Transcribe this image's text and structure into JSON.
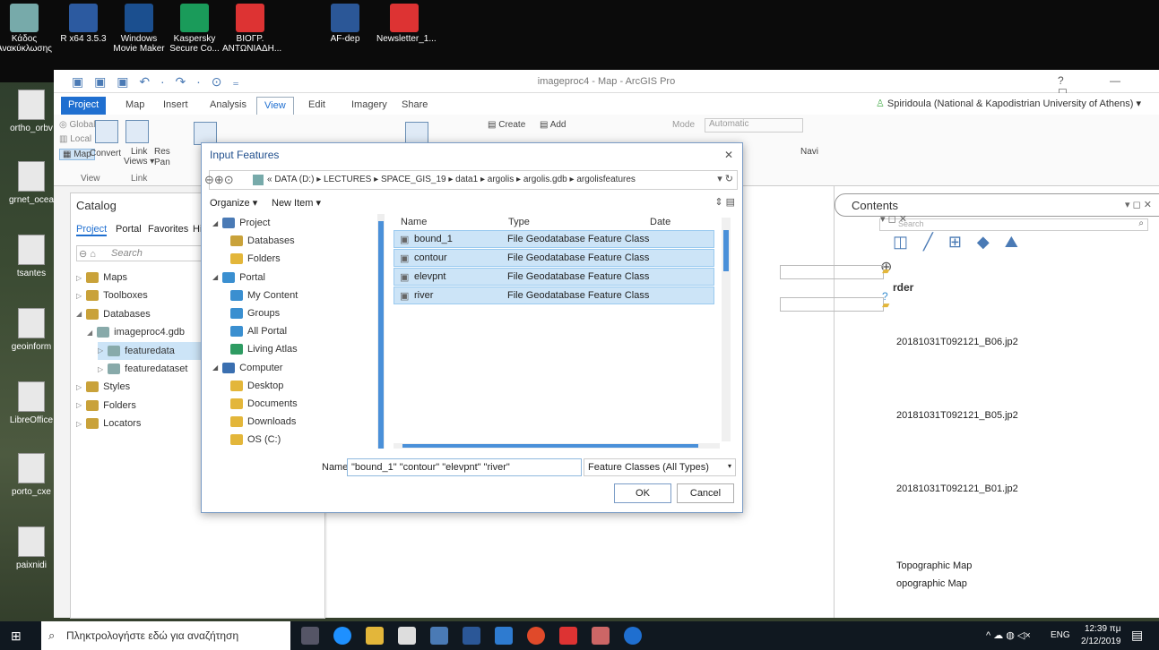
{
  "desktop_icons": [
    {
      "label": "Κάδος\nΑνακύκλωσης",
      "icon": "recycle-bin-icon",
      "color": "#7aa"
    },
    {
      "label": "R x64 3.5.3",
      "icon": "r-icon",
      "color": "#2c5aa0"
    },
    {
      "label": "Windows\nMovie Maker",
      "icon": "movie-maker-icon",
      "color": "#1b4f8f"
    },
    {
      "label": "Kaspersky\nSecure Co...",
      "icon": "kaspersky-icon",
      "color": "#1a9b5a"
    },
    {
      "label": "ΒΙΟΓΡ.\nΑΝΤΩΝΙΑΔΗ...",
      "icon": "pdf-icon",
      "color": "#d33"
    },
    {
      "label": "AF-dep",
      "icon": "word-icon",
      "color": "#2b5797"
    },
    {
      "label": "Newsletter_1...",
      "icon": "pdf-icon",
      "color": "#d33"
    }
  ],
  "side_icons": [
    "ortho_orbv",
    "grnet_ocea",
    "tsantes",
    "geoinform",
    "LibreOffice",
    "porto_cxe",
    "paixnidi"
  ],
  "arcgis": {
    "title": "imageproc4 - Map - ArcGIS Pro",
    "user": "Spiridoula (National & Kapodistrian University of Athens) ▾",
    "tabs": [
      "Project",
      "Map",
      "Insert",
      "Analysis",
      "View",
      "Edit",
      "Imagery",
      "Share"
    ],
    "active_tab": "View",
    "ribbon": {
      "global": "Global",
      "local": "Local",
      "map": "Map",
      "convert": "Convert",
      "link_views": "Link\nViews ▾",
      "res": "Res",
      "pan": "Pan",
      "view_group": "View",
      "link_group": "Link",
      "create": "Create",
      "add": "Add",
      "mode": "Mode",
      "automatic": "Automatic",
      "navi": "Navi"
    }
  },
  "catalog": {
    "title": "Catalog",
    "tabs": [
      "Project",
      "Portal",
      "Favorites",
      "His"
    ],
    "search_placeholder": "Search",
    "tree": [
      {
        "label": "Maps",
        "indent": 0
      },
      {
        "label": "Toolboxes",
        "indent": 0
      },
      {
        "label": "Databases",
        "indent": 0,
        "expanded": true
      },
      {
        "label": "imageproc4.gdb",
        "indent": 1,
        "expanded": true
      },
      {
        "label": "featuredata",
        "indent": 2,
        "selected": true
      },
      {
        "label": "featuredataset",
        "indent": 2
      },
      {
        "label": "Styles",
        "indent": 0
      },
      {
        "label": "Folders",
        "indent": 0
      },
      {
        "label": "Locators",
        "indent": 0
      }
    ]
  },
  "contents": {
    "title": "Contents",
    "search_placeholder": "Search",
    "order_label": "rder"
  },
  "geo_items": [
    "20181031T092121_B06.jp2",
    "20181031T092121_B05.jp2",
    "20181031T092121_B01.jp2",
    "Topographic Map",
    "opographic Map"
  ],
  "dialog": {
    "title": "Input Features",
    "breadcrumb": [
      "«  DATA (D:)",
      "LECTURES",
      "SPACE_GIS_19",
      "data1",
      "argolis",
      "argolis.gdb",
      "argolisfeatures"
    ],
    "organize": "Organize ▾",
    "new_item": "New Item ▾",
    "nav": [
      {
        "label": "Project",
        "indent": 0,
        "color": "#4a7ab5"
      },
      {
        "label": "Databases",
        "indent": 1,
        "color": "#c9a23a"
      },
      {
        "label": "Folders",
        "indent": 1,
        "color": "#e3b63a"
      },
      {
        "label": "Portal",
        "indent": 0,
        "color": "#3a8fd0"
      },
      {
        "label": "My Content",
        "indent": 1,
        "color": "#3a8fd0"
      },
      {
        "label": "Groups",
        "indent": 1,
        "color": "#3a8fd0"
      },
      {
        "label": "All Portal",
        "indent": 1,
        "color": "#3a8fd0"
      },
      {
        "label": "Living Atlas",
        "indent": 1,
        "color": "#2e9b62"
      },
      {
        "label": "Computer",
        "indent": 0,
        "color": "#3a6fb0"
      },
      {
        "label": "Desktop",
        "indent": 1,
        "color": "#e3b63a"
      },
      {
        "label": "Documents",
        "indent": 1,
        "color": "#e3b63a"
      },
      {
        "label": "Downloads",
        "indent": 1,
        "color": "#e3b63a"
      },
      {
        "label": "OS (C:)",
        "indent": 1,
        "color": "#e3b63a"
      }
    ],
    "columns": [
      "Name",
      "Type",
      "Date"
    ],
    "files": [
      {
        "name": "bound_1",
        "type": "File Geodatabase Feature Class"
      },
      {
        "name": "contour",
        "type": "File Geodatabase Feature Class"
      },
      {
        "name": "elevpnt",
        "type": "File Geodatabase Feature Class"
      },
      {
        "name": "river",
        "type": "File Geodatabase Feature Class"
      }
    ],
    "name_label": "Name",
    "name_value": "\"bound_1\" \"contour\" \"elevpnt\" \"river\"",
    "filter": "Feature Classes (All Types)",
    "ok": "OK",
    "cancel": "Cancel"
  },
  "taskbar": {
    "search_placeholder": "Πληκτρολογήστε εδώ για αναζήτηση",
    "lang": "ENG",
    "time": "12:39 πμ",
    "date": "2/12/2019"
  }
}
